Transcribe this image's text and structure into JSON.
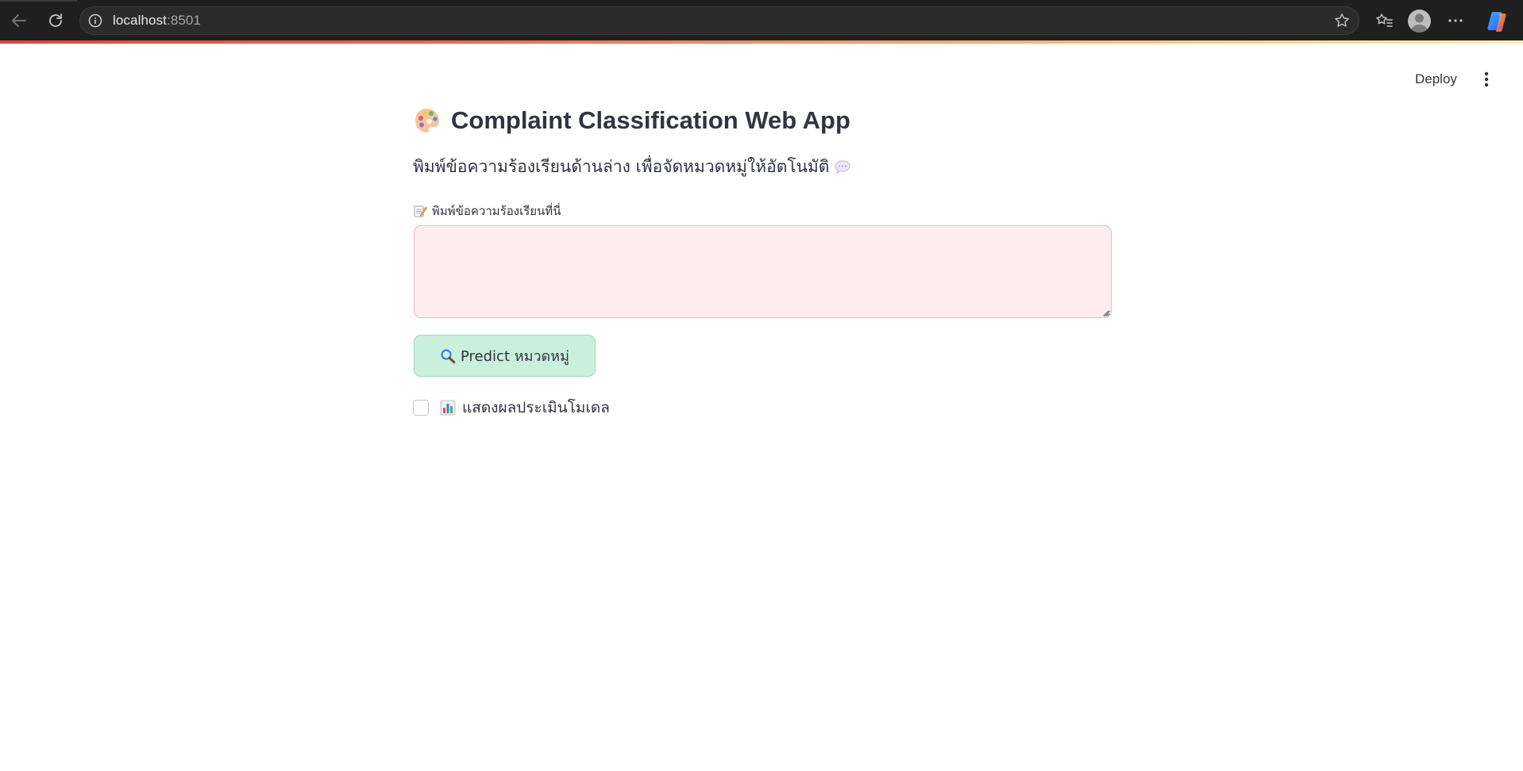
{
  "browser": {
    "url_host": "localhost",
    "url_port": ":8501",
    "icons": {
      "back": "back-arrow-icon",
      "reload": "reload-icon",
      "site_info": "info-icon",
      "favorite": "star-icon",
      "favorites_list": "favorites-icon",
      "profile": "profile-avatar-icon",
      "menu": "more-horizontal-icon",
      "copilot": "copilot-icon"
    },
    "colors": {
      "toolbar_bg": "#1f1f1f",
      "omnibox_bg": "#2b2b2b"
    }
  },
  "app_header": {
    "deploy_label": "Deploy",
    "menu_icon": "more-vertical-icon"
  },
  "main": {
    "title_icon": "palette-emoji-icon",
    "title": "Complaint Classification Web App",
    "subtitle": "พิมพ์ข้อความร้องเรียนด้านล่าง เพื่อจัดหมวดหมู่ให้อัตโนมัติ",
    "subtitle_icon": "speech-bubble-icon",
    "input": {
      "label_icon": "memo-emoji-icon",
      "label": "พิมพ์ข้อความร้องเรียนที่นี่",
      "value": "",
      "placeholder": ""
    },
    "predict_button": {
      "icon": "magnifier-emoji-icon",
      "label": "Predict หมวดหมู่"
    },
    "eval_checkbox": {
      "checked": false,
      "icon": "bar-chart-emoji-icon",
      "label": "แสดงผลประเมินโมเดล"
    }
  },
  "theme": {
    "text_color": "#31333f",
    "textarea_bg": "#fdedf1",
    "textarea_border": "#f4b6c4",
    "button_bg": "#c8f0dc",
    "button_border": "#9fdcbc"
  }
}
